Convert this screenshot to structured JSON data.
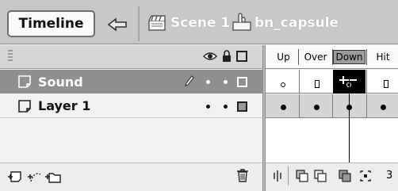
{
  "toolbar": {
    "timeline_label": "Timeline",
    "scene_label": "Scene 1",
    "symbol_label": "bn_capsule"
  },
  "layers": [
    {
      "name": "Sound",
      "selected": true,
      "editable": true,
      "visible": true,
      "locked": false,
      "outline_color": "#ffffff"
    },
    {
      "name": "Layer 1",
      "selected": false,
      "editable": false,
      "visible": true,
      "locked": false,
      "outline_color": "#9a9a9a"
    }
  ],
  "frames": {
    "headers": [
      "Up",
      "Over",
      "Down",
      "Hit"
    ],
    "active_header": "Down",
    "current_frame": "3"
  },
  "colors": {
    "selected_row": "#8f8f8f",
    "toolbar_bg": "#c8c8c8",
    "keyframe": "#000000"
  }
}
